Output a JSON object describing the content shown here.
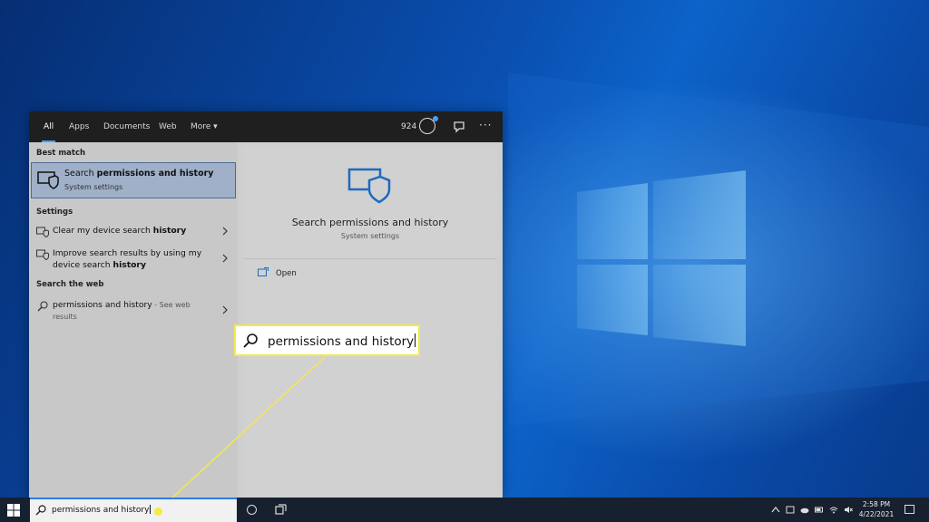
{
  "start_menu": {
    "tabs": [
      "All",
      "Apps",
      "Documents",
      "Web",
      "More ▾"
    ],
    "active_tab": "All",
    "points": "924",
    "more_dots": "···",
    "best_match": {
      "heading": "Best match",
      "title_prefix": "Search ",
      "title_bold": "permissions and history",
      "subtitle": "System settings"
    },
    "settings": {
      "heading": "Settings",
      "items": [
        {
          "prefix": "Clear my device search ",
          "bold": "history"
        },
        {
          "prefix": "Improve search results by using my device search ",
          "bold": "history"
        }
      ]
    },
    "web": {
      "heading": "Search the web",
      "query": "permissions and history",
      "suffix": " - See web results"
    },
    "details": {
      "title": "Search permissions and history",
      "subtitle": "System settings",
      "open_label": "Open"
    }
  },
  "callout": {
    "text": "permissions and history"
  },
  "taskbar": {
    "search_text": "permissions and history",
    "time": "2:58 PM",
    "date": "4/22/2021"
  },
  "colors": {
    "accent": "#2e7de0",
    "highlight": "#f2ea4a",
    "icon_blue": "#1c6bc0"
  }
}
